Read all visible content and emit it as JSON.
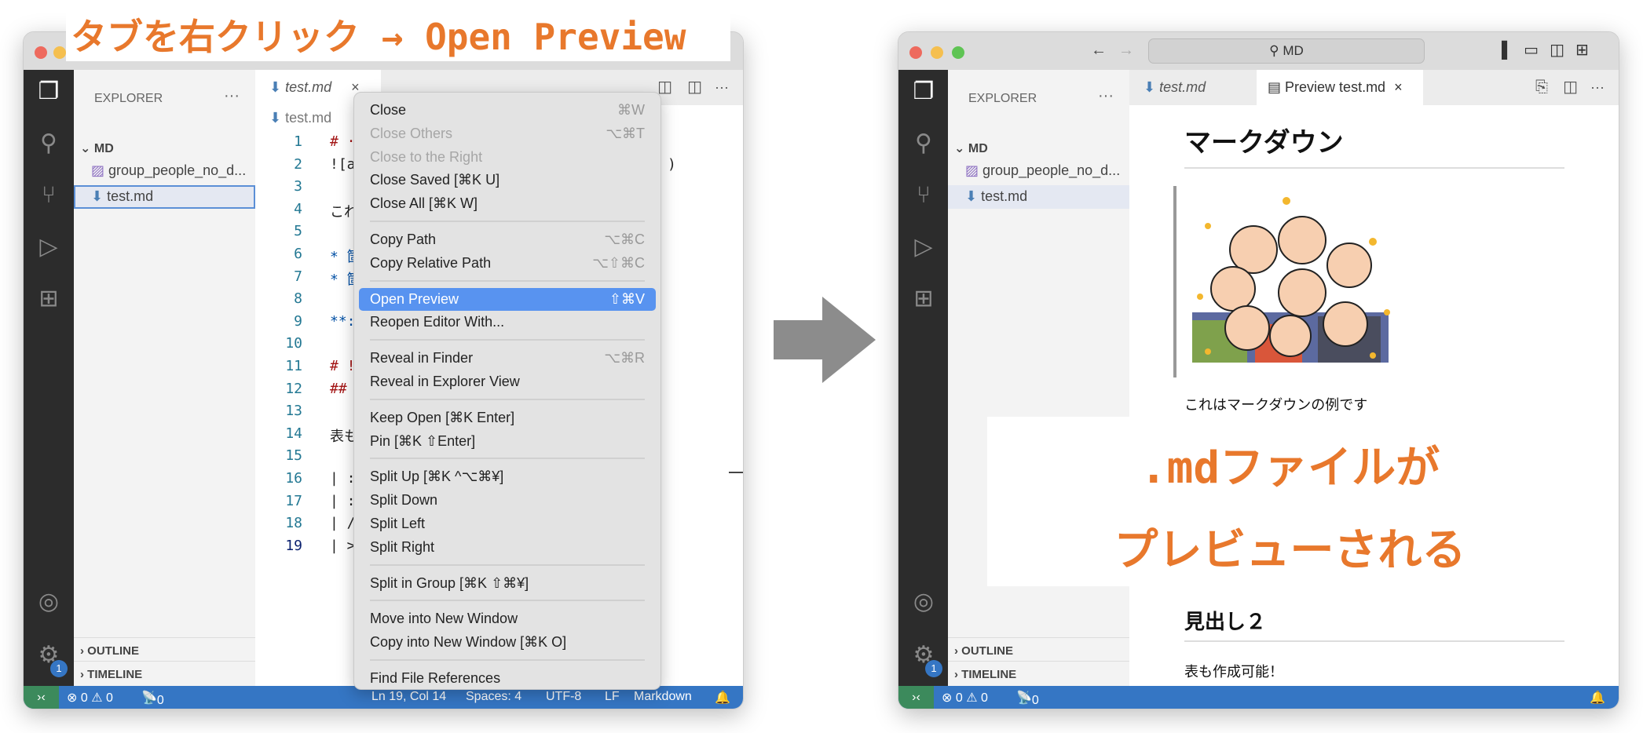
{
  "annotations": {
    "top_label": "タブを右クリック → Open Preview",
    "result_line1": ".mdファイルが",
    "result_line2": "プレビューされる"
  },
  "colors": {
    "accent": "#e8782c",
    "status_bar": "#3576c4",
    "menu_highlight": "#5893f0",
    "remote": "#3c8a5c"
  },
  "left_window": {
    "sidebar": {
      "title": "EXPLORER",
      "more": "···",
      "folder": "MD",
      "files": [
        "group_people_no_d...",
        "test.md"
      ],
      "outline": "OUTLINE",
      "timeline": "TIMELINE"
    },
    "tab": {
      "label": "test.md",
      "close": "×"
    },
    "breadcrumb": "test.md",
    "line_numbers": [
      "1",
      "2",
      "3",
      "4",
      "5",
      "6",
      "7",
      "8",
      "9",
      "10",
      "11",
      "12",
      "13",
      "14",
      "15",
      "16",
      "17",
      "18",
      "19"
    ],
    "code_fragments": [
      {
        "line": 1,
        "text": "# ·"
      },
      {
        "line": 2,
        "text": "![a"
      },
      {
        "line": 2,
        "text": ")"
      },
      {
        "line": 4,
        "text": "これ"
      },
      {
        "line": 6,
        "text": "* 箇"
      },
      {
        "line": 7,
        "text": "* 箇"
      },
      {
        "line": 9,
        "text": "**:"
      },
      {
        "line": 11,
        "text": "# !"
      },
      {
        "line": 12,
        "text": "##"
      },
      {
        "line": 14,
        "text": "表も"
      },
      {
        "line": 16,
        "text": "| :"
      },
      {
        "line": 17,
        "text": "| :"
      },
      {
        "line": 18,
        "text": "| /"
      },
      {
        "line": 19,
        "text": "| >"
      }
    ],
    "context_menu": {
      "groups": [
        [
          {
            "label": "Close",
            "shortcut": "⌘W"
          },
          {
            "label": "Close Others",
            "shortcut": "⌥⌘T",
            "disabled": true
          },
          {
            "label": "Close to the Right",
            "disabled": true
          },
          {
            "label": "Close Saved [⌘K U]"
          },
          {
            "label": "Close All [⌘K W]"
          }
        ],
        [
          {
            "label": "Copy Path",
            "shortcut": "⌥⌘C"
          },
          {
            "label": "Copy Relative Path",
            "shortcut": "⌥⇧⌘C"
          }
        ],
        [
          {
            "label": "Open Preview",
            "shortcut": "⇧⌘V",
            "selected": true
          },
          {
            "label": "Reopen Editor With..."
          }
        ],
        [
          {
            "label": "Reveal in Finder",
            "shortcut": "⌥⌘R"
          },
          {
            "label": "Reveal in Explorer View"
          }
        ],
        [
          {
            "label": "Keep Open [⌘K Enter]"
          },
          {
            "label": "Pin [⌘K ⇧Enter]"
          }
        ],
        [
          {
            "label": "Split Up [⌘K ^⌥⌘¥]"
          },
          {
            "label": "Split Down"
          },
          {
            "label": "Split Left"
          },
          {
            "label": "Split Right"
          }
        ],
        [
          {
            "label": "Split in Group [⌘K ⇧⌘¥]"
          }
        ],
        [
          {
            "label": "Move into New Window"
          },
          {
            "label": "Copy into New Window [⌘K O]"
          }
        ],
        [
          {
            "label": "Find File References"
          }
        ]
      ]
    },
    "status": {
      "errors": "⊗ 0 ⚠ 0",
      "ports": "0",
      "position": "Ln 19, Col 14",
      "spaces": "Spaces: 4",
      "encoding": "UTF-8",
      "eol": "LF",
      "language": "Markdown"
    },
    "settings_badge": "1"
  },
  "right_window": {
    "search": "MD",
    "sidebar": {
      "title": "EXPLORER",
      "more": "···",
      "folder": "MD",
      "files": [
        "group_people_no_d...",
        "test.md"
      ],
      "outline": "OUTLINE",
      "timeline": "TIMELINE"
    },
    "tabs": [
      {
        "label": "test.md"
      },
      {
        "label": "Preview test.md",
        "close": "×"
      }
    ],
    "preview": {
      "h1": "マークダウン",
      "paragraph": "これはマークダウンの例です",
      "h2": "見出し２",
      "paragraph2": "表も作成可能！"
    },
    "status": {
      "errors": "⊗ 0 ⚠ 0",
      "ports": "0"
    },
    "settings_badge": "1"
  }
}
